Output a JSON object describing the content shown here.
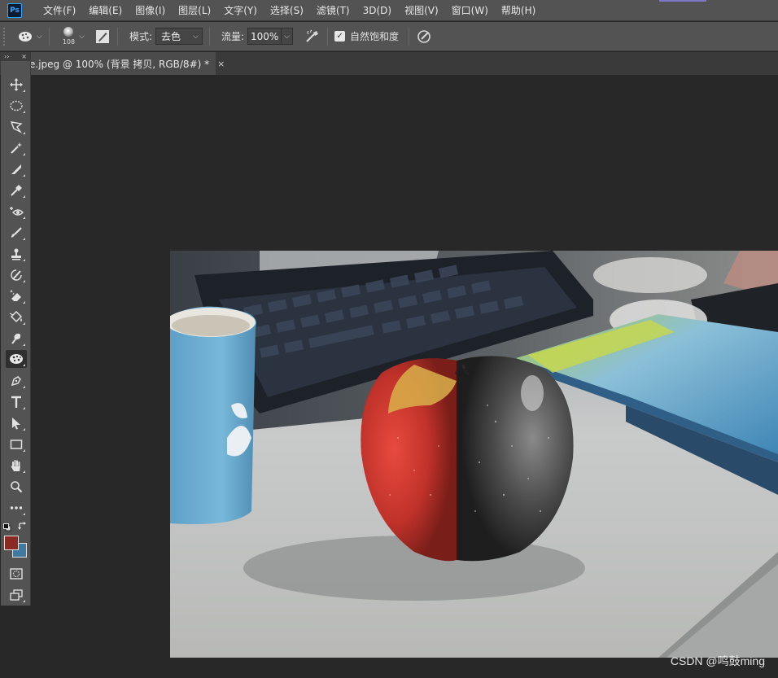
{
  "app": {
    "logo": "Ps"
  },
  "menu": [
    "文件(F)",
    "编辑(E)",
    "图像(I)",
    "图层(L)",
    "文字(Y)",
    "选择(S)",
    "滤镜(T)",
    "3D(D)",
    "视图(V)",
    "窗口(W)",
    "帮助(H)"
  ],
  "options": {
    "brush_size": "108",
    "mode_label": "模式:",
    "mode_value": "去色",
    "flow_label": "流量:",
    "flow_value": "100%",
    "vibrance_label": "自然饱和度",
    "vibrance_checked": true
  },
  "document_tab": {
    "title": "e.jpeg @ 100% (背景 拷贝, RGB/8#) *",
    "close": "×"
  },
  "toolbox": {
    "header_left": "››",
    "header_right": "×",
    "tools": [
      "move-tool",
      "marquee-tool",
      "lasso-tool",
      "magic-wand-tool",
      "crop-tool",
      "eyedropper-tool",
      "spot-healing-tool",
      "brush-tool",
      "clone-stamp-tool",
      "history-brush-tool",
      "eraser-tool",
      "gradient-tool",
      "smudge-tool",
      "sponge-tool",
      "pen-tool",
      "type-tool",
      "path-selection-tool",
      "rectangle-tool",
      "hand-tool",
      "zoom-tool",
      "more-tools"
    ],
    "active_tool": "sponge-tool",
    "foreground_color": "#8b2a22",
    "background_color": "#3f7aa0"
  },
  "watermark": "CSDN @鸣鼓ming"
}
